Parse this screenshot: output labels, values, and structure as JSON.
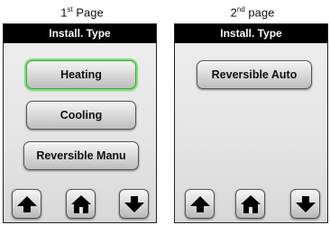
{
  "pages": [
    {
      "caption_num": "1",
      "caption_sup": "st",
      "caption_text": " Page",
      "title": "Install. Type",
      "options": [
        {
          "label": "Heating",
          "selected": true
        },
        {
          "label": "Cooling",
          "selected": false
        },
        {
          "label": "Reversible Manu",
          "selected": false
        }
      ],
      "nav": {
        "up_icon": "arrow-up-icon",
        "home_icon": "home-icon",
        "down_icon": "arrow-down-icon"
      }
    },
    {
      "caption_num": "2",
      "caption_sup": "nd",
      "caption_text": " page",
      "title": "Install. Type",
      "options": [
        {
          "label": "Reversible Auto",
          "selected": false
        }
      ],
      "nav": {
        "up_icon": "arrow-up-icon",
        "home_icon": "home-icon",
        "down_icon": "arrow-down-icon"
      }
    }
  ],
  "colors": {
    "title_bar": "#000000",
    "title_text": "#ffffff",
    "selected_highlight": "#7ee07a",
    "icon": "#000000"
  }
}
